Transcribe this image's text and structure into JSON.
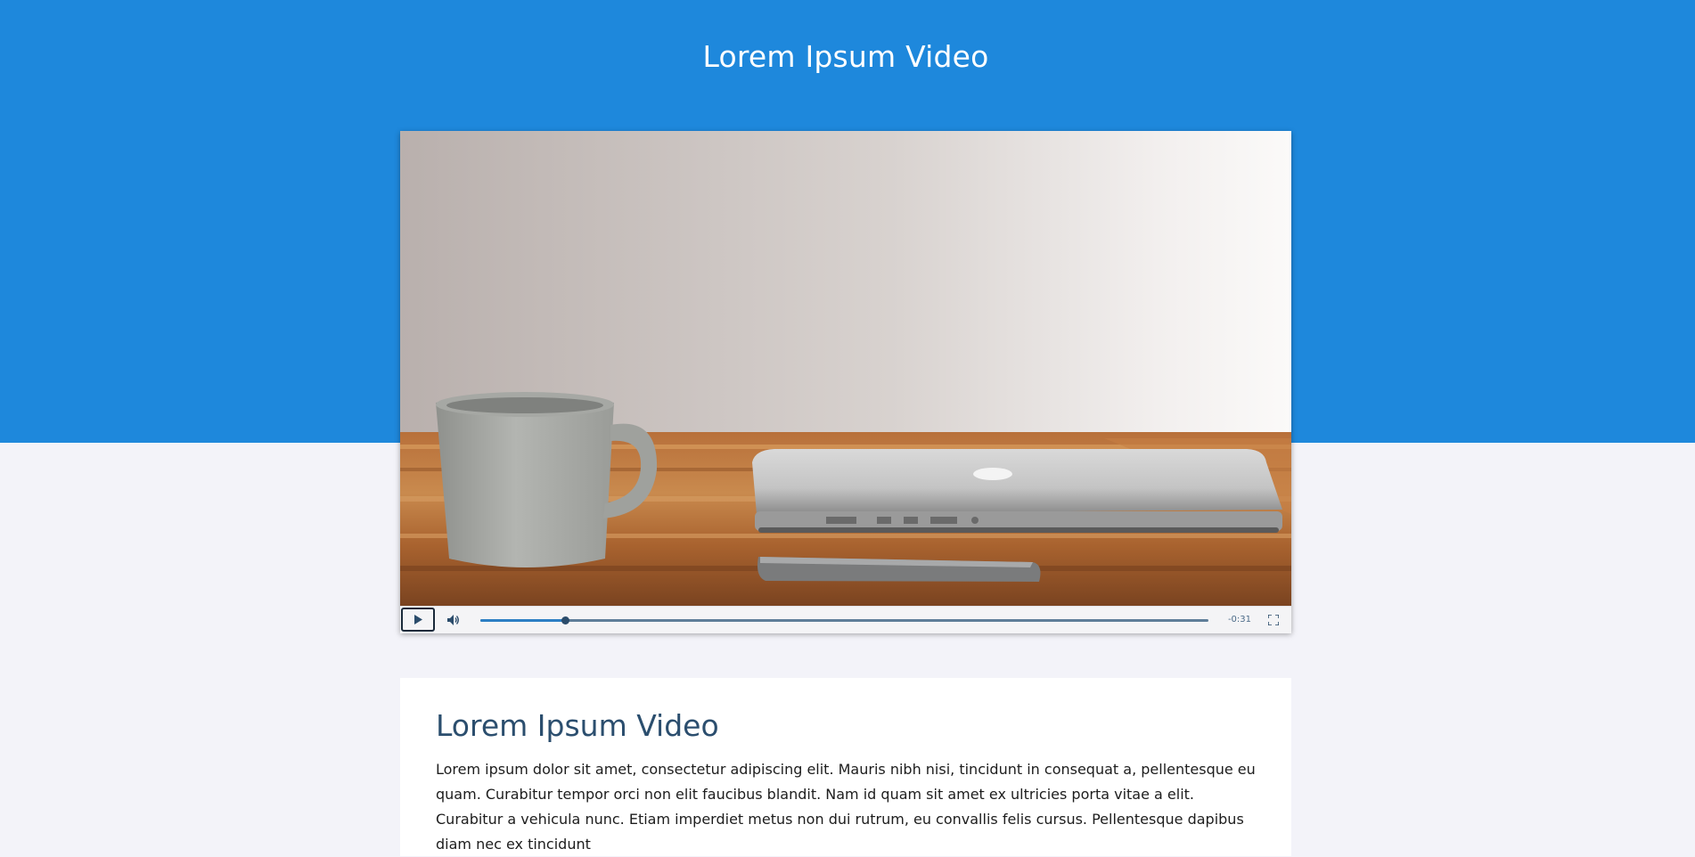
{
  "hero": {
    "title": "Lorem Ipsum Video"
  },
  "player": {
    "poster_description_icon": "video-frame",
    "time_remaining": "-0:31",
    "progress_fraction": 0.116,
    "icons": {
      "play": "play-icon",
      "volume": "volume-icon",
      "fullscreen": "fullscreen-icon"
    }
  },
  "content": {
    "title": "Lorem Ipsum Video",
    "body": "Lorem ipsum dolor sit amet, consectetur adipiscing elit. Mauris nibh nisi, tincidunt in consequat a, pellentesque eu quam. Curabitur tempor orci non elit faucibus blandit. Nam id quam sit amet ex ultricies porta vitae a elit. Curabitur a vehicula nunc. Etiam imperdiet metus non dui rutrum, eu convallis felis cursus. Pellentesque dapibus diam nec ex tincidunt"
  },
  "colors": {
    "hero": "#1e88dc",
    "page_background": "#f3f3f9",
    "heading": "#2b4e6e",
    "progress": "#2c7fc4"
  }
}
